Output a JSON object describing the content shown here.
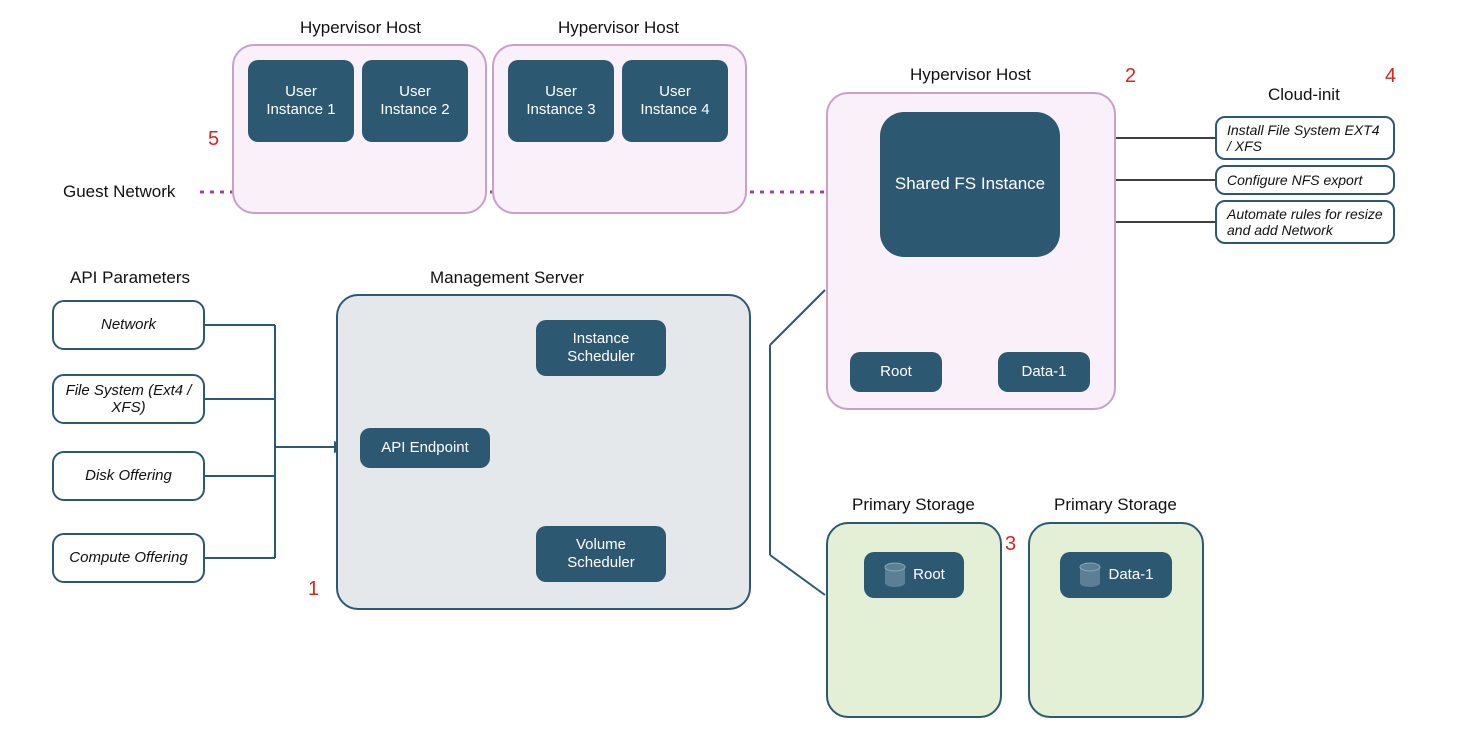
{
  "labels": {
    "hypervisor_host": "Hypervisor Host",
    "guest_network": "Guest Network",
    "api_parameters": "API Parameters",
    "management_server": "Management Server",
    "primary_storage": "Primary Storage",
    "cloud_init": "Cloud-init"
  },
  "user_instances": {
    "i1": "User Instance 1",
    "i2": "User Instance 2",
    "i3": "User Instance 3",
    "i4": "User Instance 4"
  },
  "shared_fs_instance": "Shared FS Instance",
  "volumes": {
    "root": "Root",
    "data1": "Data-1"
  },
  "mgmt": {
    "api_endpoint": "API Endpoint",
    "instance_scheduler": "Instance Scheduler",
    "volume_scheduler": "Volume Scheduler"
  },
  "params": {
    "network": "Network",
    "file_system": "File System (Ext4 / XFS)",
    "disk_offering": "Disk Offering",
    "compute_offering": "Compute Offering"
  },
  "cloud_init_steps": {
    "install_fs": "Install File System EXT4 / XFS",
    "configure_nfs": "Configure NFS export",
    "automate": "Automate rules for resize and add Network"
  },
  "numbers": {
    "n1": "1",
    "n2": "2",
    "n3": "3",
    "n4": "4",
    "n5": "5"
  }
}
